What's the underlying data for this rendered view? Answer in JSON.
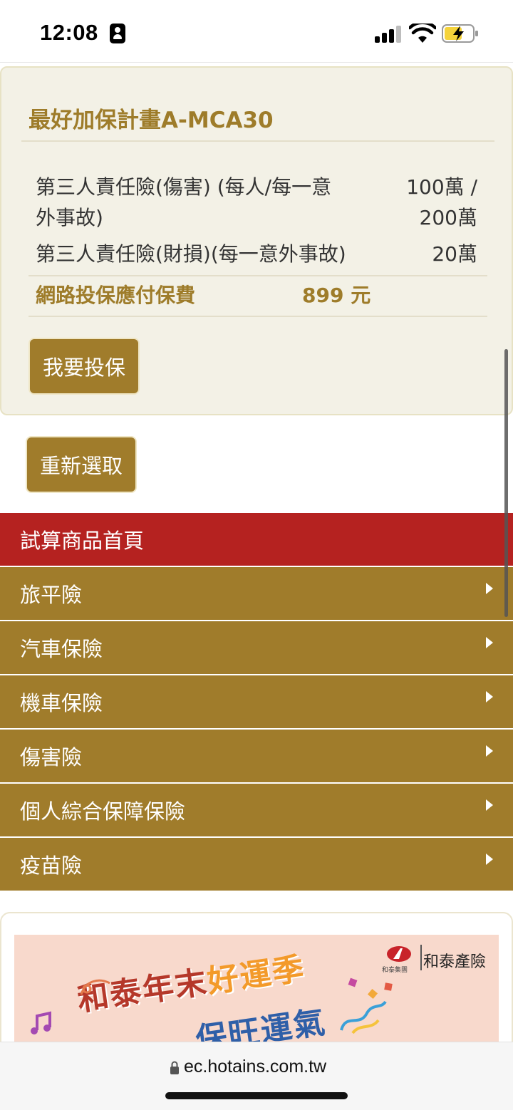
{
  "status_bar": {
    "time": "12:08"
  },
  "plan": {
    "title": "最好加保計畫A-MCA30",
    "coverages": [
      {
        "name_line1": "第三人責任險(傷害) (每人/每一意",
        "name_line2": "外事故)",
        "value_line1": "100萬 /",
        "value_line2": "200萬"
      },
      {
        "name_line1": "第三人責任險(財損)(每一意外事故)",
        "value_line1": "20萬"
      }
    ],
    "premium_label": "網路投保應付保費",
    "premium_value": "899 元",
    "apply_button": "我要投保"
  },
  "reselect_button": "重新選取",
  "nav": {
    "home": "試算商品首頁",
    "items": [
      {
        "label": "旅平險"
      },
      {
        "label": "汽車保險"
      },
      {
        "label": "機車保險"
      },
      {
        "label": "傷害險"
      },
      {
        "label": "個人綜合保障保險"
      },
      {
        "label": "疫苗險"
      }
    ]
  },
  "banner": {
    "brand_group": "和泰集團",
    "brand_name": "和泰產險",
    "promo_part1": "和泰年末",
    "promo_part2": "好運季",
    "promo_line2": "保旺運氣"
  },
  "url_bar": {
    "url": "ec.hotains.com.tw"
  },
  "colors": {
    "gold": "#a07c2b",
    "red": "#b52220",
    "card_bg": "#f3f1e6"
  }
}
